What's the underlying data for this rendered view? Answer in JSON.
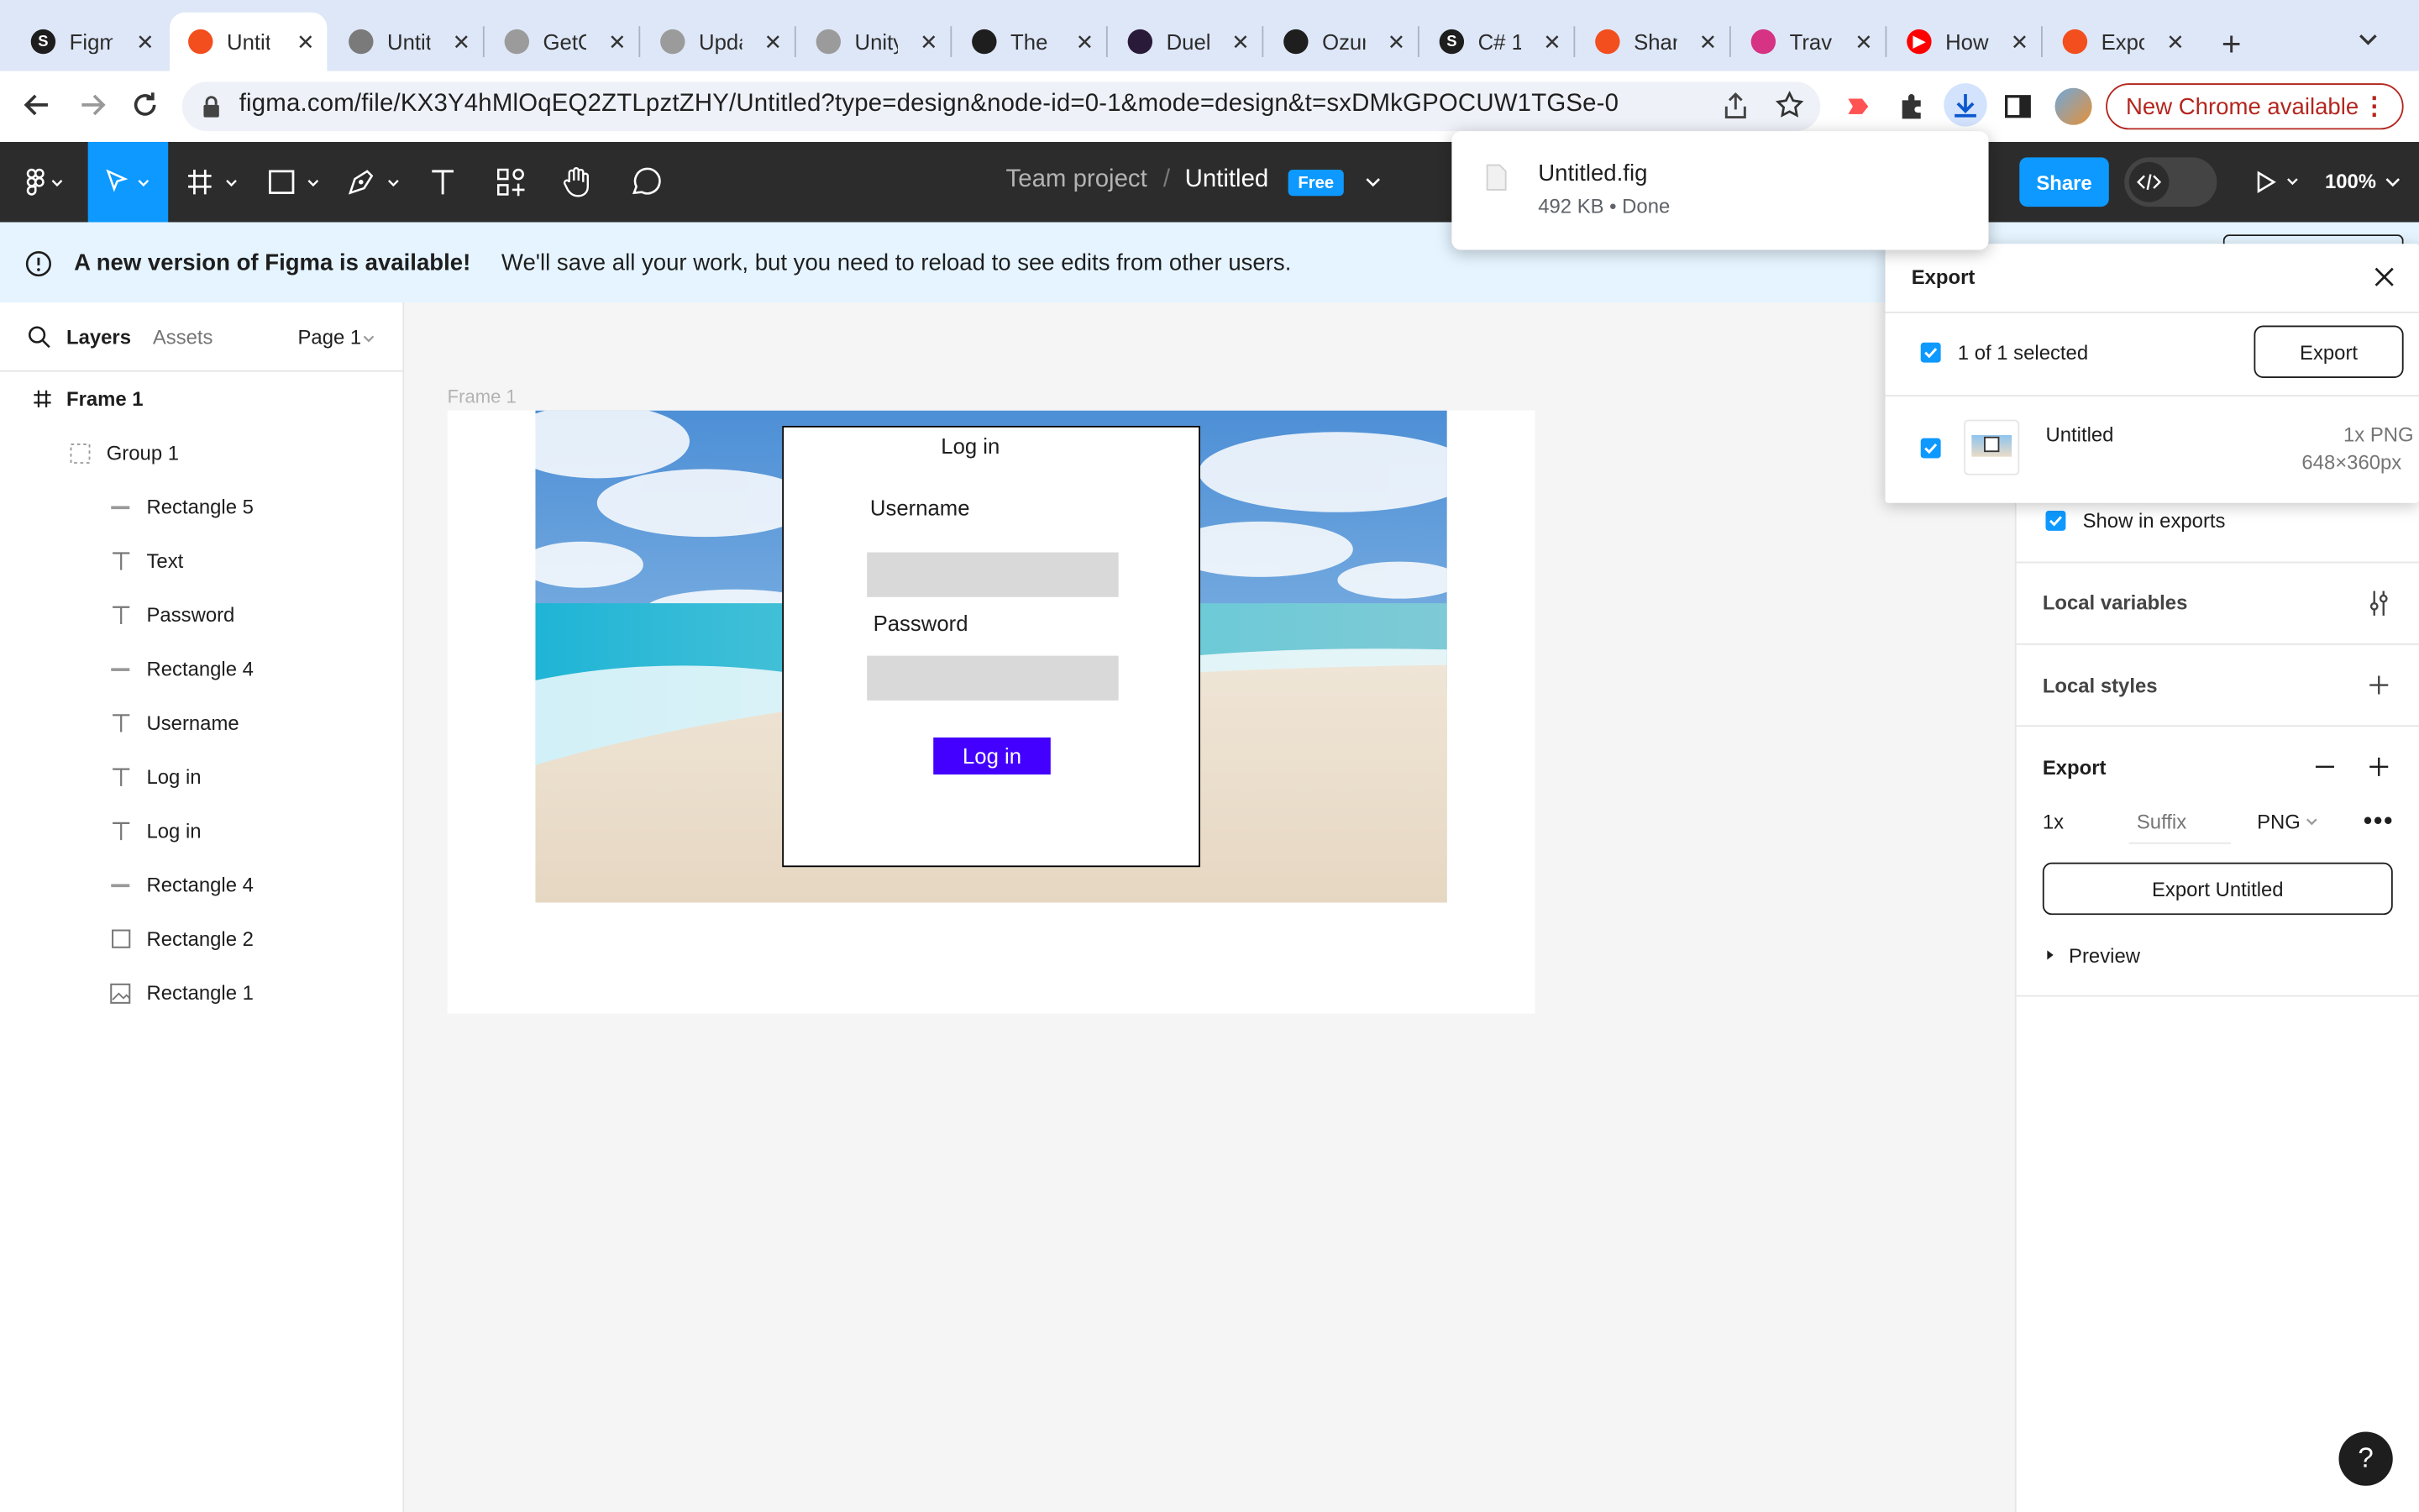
{
  "browser": {
    "tabs": [
      {
        "title": "Figma",
        "icon": "s-icon",
        "color": "#1e1e1e",
        "glyph": "S"
      },
      {
        "title": "Untitled",
        "icon": "figma-icon",
        "color": "#f24e1e",
        "glyph": ""
      },
      {
        "title": "Untitled",
        "icon": "globe-icon",
        "color": "#7a7a7a",
        "glyph": ""
      },
      {
        "title": "GetOrder",
        "icon": "unity-icon",
        "color": "#9b9b9b",
        "glyph": ""
      },
      {
        "title": "Update",
        "icon": "unity-icon",
        "color": "#9b9b9b",
        "glyph": ""
      },
      {
        "title": "Unity",
        "icon": "unity-icon",
        "color": "#9b9b9b",
        "glyph": ""
      },
      {
        "title": "The",
        "icon": "github-icon",
        "color": "#1e1e1e",
        "glyph": ""
      },
      {
        "title": "Duel",
        "icon": "duel-icon",
        "color": "#2a1a3a",
        "glyph": ""
      },
      {
        "title": "Ozur",
        "icon": "github-icon",
        "color": "#1e1e1e",
        "glyph": ""
      },
      {
        "title": "C# 1",
        "icon": "s-icon",
        "color": "#1e1e1e",
        "glyph": "S"
      },
      {
        "title": "Share",
        "icon": "figma-icon",
        "color": "#f24e1e",
        "glyph": ""
      },
      {
        "title": "Travel",
        "icon": "travel-icon",
        "color": "#d63384",
        "glyph": ""
      },
      {
        "title": "How",
        "icon": "youtube-icon",
        "color": "#ff0000",
        "glyph": "▶"
      },
      {
        "title": "Export",
        "icon": "figma-icon",
        "color": "#f24e1e",
        "glyph": ""
      }
    ],
    "url": "figma.com/file/KX3Y4hMlOqEQ2ZTLpztZHY/Untitled?type=design&node-id=0-1&mode=design&t=sxDMkGPOCUW1TGSe-0",
    "new_chrome": "New Chrome available",
    "download": {
      "filename": "Untitled.fig",
      "status": "492 KB • Done"
    }
  },
  "toolbar": {
    "team": "Team project",
    "sep": "/",
    "file": "Untitled",
    "badge": "Free",
    "share": "Share",
    "zoom": "100%"
  },
  "banner": {
    "title": "A new version of Figma is available!",
    "message": "We'll save all your work, but you need to reload to see edits from other users."
  },
  "left_panel": {
    "tabs": {
      "layers": "Layers",
      "assets": "Assets"
    },
    "page": "Page 1",
    "layers": [
      {
        "name": "Frame 1",
        "icon": "frame-icon",
        "level": 0
      },
      {
        "name": "Group 1",
        "icon": "group-icon",
        "level": 1
      },
      {
        "name": "Rectangle 5",
        "icon": "line-icon",
        "level": 2
      },
      {
        "name": "Text",
        "icon": "text-icon",
        "level": 2
      },
      {
        "name": "Password",
        "icon": "text-icon",
        "level": 2
      },
      {
        "name": "Rectangle 4",
        "icon": "line-icon",
        "level": 2
      },
      {
        "name": "Username",
        "icon": "text-icon",
        "level": 2
      },
      {
        "name": "Log in",
        "icon": "text-icon",
        "level": 2
      },
      {
        "name": "Log in",
        "icon": "text-icon",
        "level": 2
      },
      {
        "name": "Rectangle 4",
        "icon": "line-icon",
        "level": 2
      },
      {
        "name": "Rectangle 2",
        "icon": "rectangle-icon",
        "level": 2
      },
      {
        "name": "Rectangle 1",
        "icon": "image-icon",
        "level": 2
      }
    ]
  },
  "canvas": {
    "frame_label": "Frame 1",
    "login": {
      "title": "Log in",
      "username_label": "Username",
      "password_label": "Password",
      "button": "Log in",
      "button_color": "#4400ff"
    }
  },
  "export_popover": {
    "title": "Export",
    "selected": "1 of 1 selected",
    "button": "Export",
    "item_name": "Untitled",
    "item_format": "1x PNG",
    "item_size": "648×360px"
  },
  "right_panel": {
    "show_in_exports": "Show in exports",
    "local_variables": "Local variables",
    "local_styles": "Local styles",
    "export_title": "Export",
    "scale": "1x",
    "suffix_placeholder": "Suffix",
    "format": "PNG",
    "export_button": "Export Untitled",
    "preview": "Preview"
  },
  "help": "?"
}
